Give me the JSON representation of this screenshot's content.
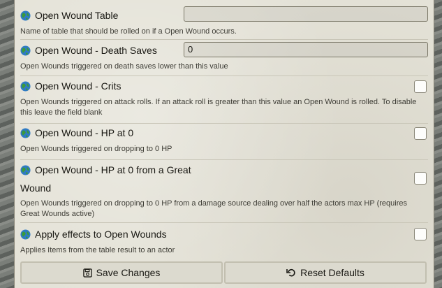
{
  "settings": [
    {
      "label": "Open Wound Table",
      "hint": "Name of table that should be rolled on if a Open Wound occurs.",
      "type": "text",
      "value": ""
    },
    {
      "label": "Open Wound - Death Saves",
      "hint": "Open Wounds triggered on death saves lower than this value",
      "type": "text",
      "value": "0"
    },
    {
      "label": "Open Wound - Crits",
      "hint": "Open Wounds triggered on attack rolls. If an attack roll is greater than this value an Open Wound is rolled. To disable this leave the field blank",
      "type": "checkbox",
      "checked": false
    },
    {
      "label": "Open Wound - HP at 0",
      "hint": "Open Wounds triggered on dropping to 0 HP",
      "type": "checkbox",
      "checked": false
    },
    {
      "label_line1": "Open Wound - HP at 0 from a Great",
      "label_line2": "Wound",
      "hint": "Open Wounds triggered on dropping to 0 HP from a damage source dealing over half the actors max HP (requires Great Wounds active)",
      "type": "checkbox",
      "checked": false
    },
    {
      "label": "Apply effects to Open Wounds",
      "hint": "Applies Items from the table result to an actor",
      "type": "checkbox",
      "checked": false
    }
  ],
  "buttons": {
    "save_label": "Save Changes",
    "reset_label": "Reset Defaults"
  },
  "icons": {
    "scope": "globe-icon",
    "save": "save-icon",
    "reset": "undo-icon"
  },
  "colors": {
    "panel": "#e4e2d7",
    "text": "#191813",
    "border": "#7b7868"
  }
}
